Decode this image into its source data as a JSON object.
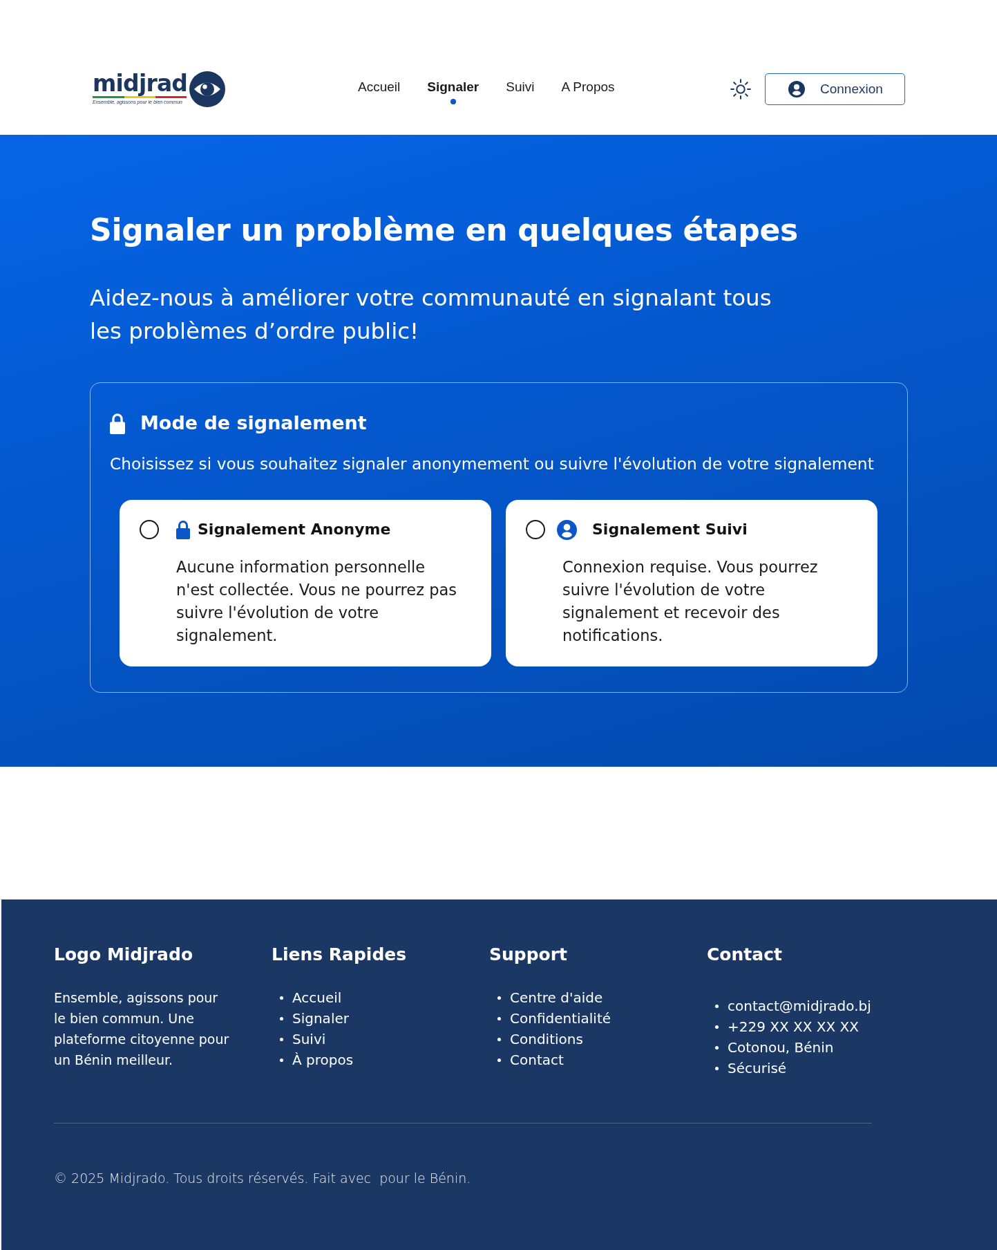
{
  "header": {
    "logo": {
      "wordmark": "midjrad",
      "tagline": "Ensemble, agissons pour le bien commun"
    },
    "nav": [
      {
        "label": "Accueil",
        "selected": false
      },
      {
        "label": "Signaler",
        "selected": true
      },
      {
        "label": "Suivi",
        "selected": false
      },
      {
        "label": "A Propos",
        "selected": false
      }
    ],
    "login_button": {
      "label": "Connexion"
    }
  },
  "hero": {
    "title": "Signaler un problème en quelques étapes",
    "subtitle": "Aidez-nous à améliorer votre communauté en signalant tous les problèmes d’ordre public!",
    "mode_panel": {
      "title": "Mode de signalement",
      "description": "Choisissez si vous souhaitez signaler anonymement ou suivre l'évolution de votre signalement",
      "options": [
        {
          "title": "Signalement Anonyme",
          "description": "Aucune information personnelle n'est collectée. Vous ne pourrez pas suivre l'évolution de votre signalement.",
          "selected": false
        },
        {
          "title": "Signalement Suivi",
          "description": "Connexion requise. Vous pourrez suivre l'évolution de votre signalement et recevoir des notifications.",
          "selected": false
        }
      ]
    }
  },
  "footer": {
    "columns": [
      {
        "kind": "about",
        "title": "Logo Midjrado",
        "text": "Ensemble, agissons pour le bien commun. Une plateforme citoyenne pour un Bénin meilleur."
      },
      {
        "kind": "links",
        "title": "Liens Rapides",
        "items": [
          "Accueil",
          "Signaler",
          "Suivi",
          "À propos"
        ]
      },
      {
        "kind": "links",
        "title": "Support",
        "items": [
          "Centre d'aide",
          "Confidentialité",
          "Conditions",
          "Contact"
        ]
      },
      {
        "kind": "contact",
        "title": "Contact",
        "items": [
          "contact@midjrado.bj",
          "+229 XX XX XX XX",
          "Cotonou, Bénin",
          "Sécurisé"
        ]
      }
    ],
    "copyright": "© 2025 Midjrado. Tous droits réservés. Fait avec  pour le Bénin."
  }
}
